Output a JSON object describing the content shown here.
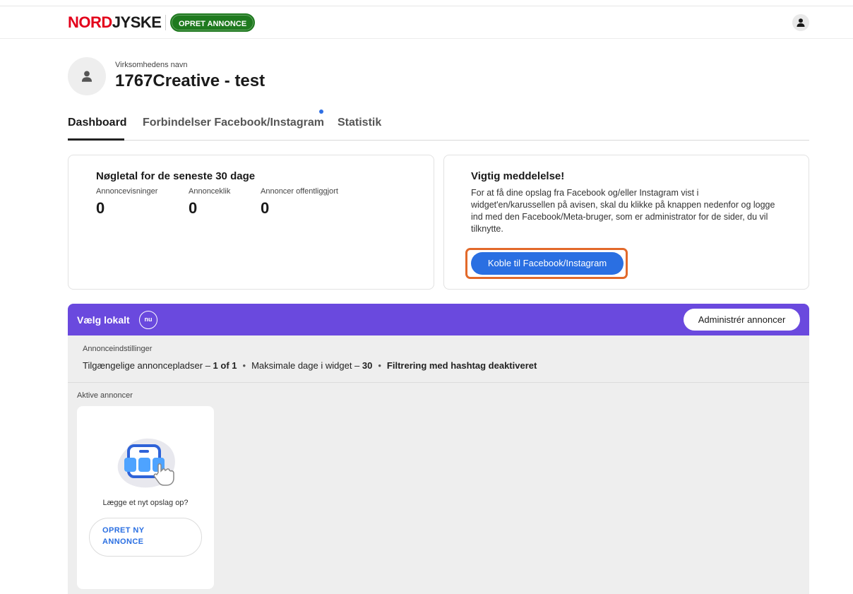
{
  "header": {
    "logo_part1": "NORD",
    "logo_part2": "JYSKE",
    "opret_label": "OPRET ANNONCE",
    "user_icon": "user-icon"
  },
  "business": {
    "label": "Virksomhedens navn",
    "name": "1767Creative - test",
    "avatar_icon": "user-icon"
  },
  "tabs": [
    {
      "label": "Dashboard",
      "active": true
    },
    {
      "label": "Forbindelser Facebook/Instagram",
      "active": false,
      "notification_dot": true
    },
    {
      "label": "Statistik",
      "active": false
    }
  ],
  "stats_card": {
    "title": "Nøgletal for de seneste 30 dage",
    "items": [
      {
        "label": "Annoncevisninger",
        "value": "0"
      },
      {
        "label": "Annonceklik",
        "value": "0"
      },
      {
        "label": "Annoncer offentliggjort",
        "value": "0"
      }
    ]
  },
  "notice_card": {
    "title": "Vigtig meddelelse!",
    "text": "For at få dine opslag fra Facebook og/eller Instagram vist i widget'en/karussellen på avisen, skal du klikke på knappen nedenfor og logge ind med den Facebook/Meta-bruger, som er administrator for de sider, du vil tilknytte.",
    "button_label": "Koble til Facebook/Instagram"
  },
  "local_bar": {
    "title": "Vælg lokalt",
    "icon_text": "nu",
    "admin_button": "Administrér annoncer"
  },
  "settings": {
    "label": "Annonceindstillinger",
    "slots_prefix": "Tilgængelige annoncepladser – ",
    "slots_value": "1 of 1",
    "days_prefix": "Maksimale dage i widget – ",
    "days_value": "30",
    "filter": "Filtrering med hashtag deaktiveret",
    "separator": "•"
  },
  "active_ads": {
    "label": "Aktive annoncer",
    "card_question": "Lægge et nyt opslag op?",
    "create_button": "OPRET NY ANNONCE"
  },
  "colors": {
    "brand_red": "#e3001b",
    "green": "#1f7a1f",
    "purple": "#6a49de",
    "blue": "#2a6fe2",
    "highlight_orange": "#e2692a"
  }
}
